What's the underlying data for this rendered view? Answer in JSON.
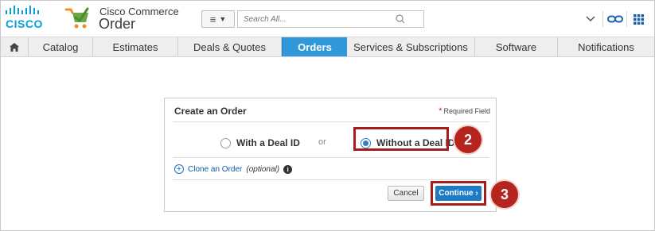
{
  "header": {
    "brand_mark": "CISCO",
    "brand_sub": "Cisco Commerce",
    "brand_main": "Order",
    "search_placeholder": "Search All..."
  },
  "nav": {
    "items": [
      "Catalog",
      "Estimates",
      "Deals & Quotes",
      "Orders",
      "Services & Subscriptions",
      "Software",
      "Notifications"
    ],
    "active": "Orders"
  },
  "dialog": {
    "title": "Create an Order",
    "required_star": "*",
    "required_label": "Required Field",
    "option_with": "With a Deal ID",
    "or_label": "or",
    "option_without": "Without a Deal ID",
    "selected": "Without a Deal ID",
    "clone_link": "Clone an Order",
    "clone_optional": "(optional)",
    "info_glyph": "i",
    "cancel_label": "Cancel",
    "continue_label": "Continue ›"
  },
  "steps": [
    "2",
    "3"
  ],
  "colors": {
    "accent_blue": "#3097d8",
    "highlight_red": "#a61c1c",
    "cisco_blue": "#049fd9"
  }
}
